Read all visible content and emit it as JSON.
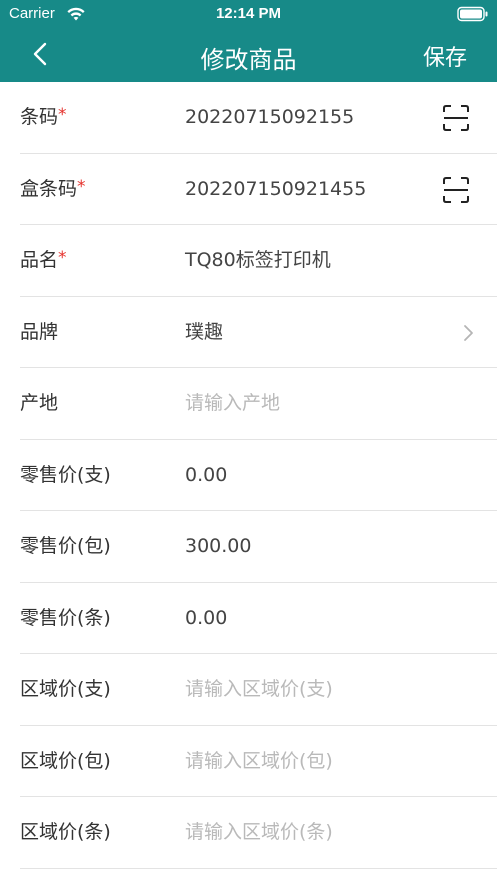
{
  "status_bar": {
    "carrier": "Carrier",
    "time": "12:14 PM"
  },
  "nav": {
    "title": "修改商品",
    "save_label": "保存",
    "background_color": "#178a88"
  },
  "form": {
    "barcode": {
      "label": "条码",
      "required_mark": "*",
      "value": "20220715092155"
    },
    "box_barcode": {
      "label": "盒条码",
      "required_mark": "*",
      "value": "202207150921455"
    },
    "name": {
      "label": "品名",
      "required_mark": "*",
      "value": "TQ80标签打印机"
    },
    "brand": {
      "label": "品牌",
      "value": "璞趣"
    },
    "origin": {
      "label": "产地",
      "placeholder": "请输入产地"
    },
    "retail_price_stick": {
      "label": "零售价(支)",
      "value": "0.00"
    },
    "retail_price_pack": {
      "label": "零售价(包)",
      "value": "300.00"
    },
    "retail_price_carton": {
      "label": "零售价(条)",
      "value": "0.00"
    },
    "regional_price_stick": {
      "label": "区域价(支)",
      "placeholder": "请输入区域价(支)"
    },
    "regional_price_pack": {
      "label": "区域价(包)",
      "placeholder": "请输入区域价(包)"
    },
    "regional_price_carton": {
      "label": "区域价(条)",
      "placeholder": "请输入区域价(条)"
    }
  }
}
